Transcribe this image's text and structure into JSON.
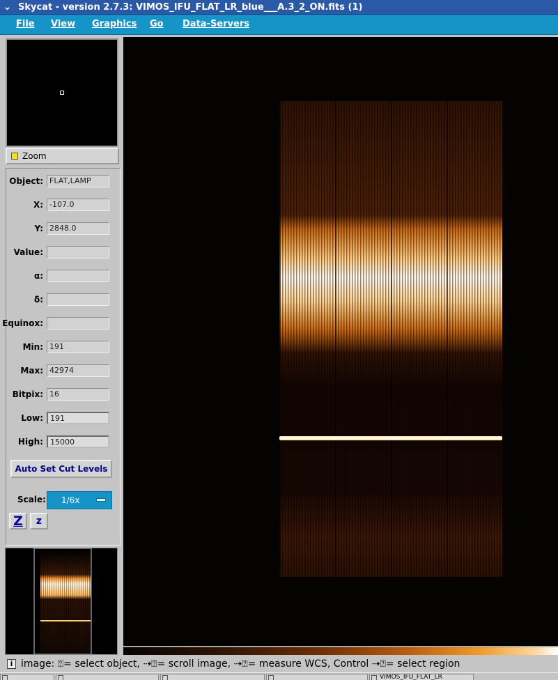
{
  "window": {
    "title": "Skycat - version 2.7.3: VIMOS_IFU_FLAT_LR_blue___A.3_2_ON.fits (1)"
  },
  "menu": [
    "File",
    "View",
    "Graphics",
    "Go",
    "Data-Servers"
  ],
  "zoom_toggle": {
    "label": "Zoom"
  },
  "info": [
    {
      "label": "Object:",
      "value": "FLAT,LAMP"
    },
    {
      "label": "X:",
      "value": "-107.0"
    },
    {
      "label": "Y:",
      "value": "2848.0"
    },
    {
      "label": "Value:",
      "value": ""
    },
    {
      "label": "α:",
      "value": ""
    },
    {
      "label": "δ:",
      "value": ""
    },
    {
      "label": "Equinox:",
      "value": ""
    },
    {
      "label": "Min:",
      "value": "191"
    },
    {
      "label": "Max:",
      "value": "42974"
    },
    {
      "label": "Bitpix:",
      "value": "16"
    },
    {
      "label": "Low:",
      "value": "191"
    },
    {
      "label": "High:",
      "value": "15000"
    }
  ],
  "autocut": {
    "label": "Auto Set Cut Levels"
  },
  "scale": {
    "label": "Scale:",
    "value": "1/6x"
  },
  "zoom_buttons": {
    "in": "Z",
    "out": "z"
  },
  "status": {
    "text": "image: ⍰= select object, ⇢⍰= scroll image, ⇢⍰= measure WCS, Control ⇢⍰= select region"
  },
  "taskbar": [
    "",
    "",
    "",
    "",
    "",
    "",
    "VIMOS_IFU_FLAT_LR"
  ],
  "colors": {
    "menubar": "#1694c8",
    "titlebar": "#2a59a8",
    "panel": "#c5c5c5"
  }
}
